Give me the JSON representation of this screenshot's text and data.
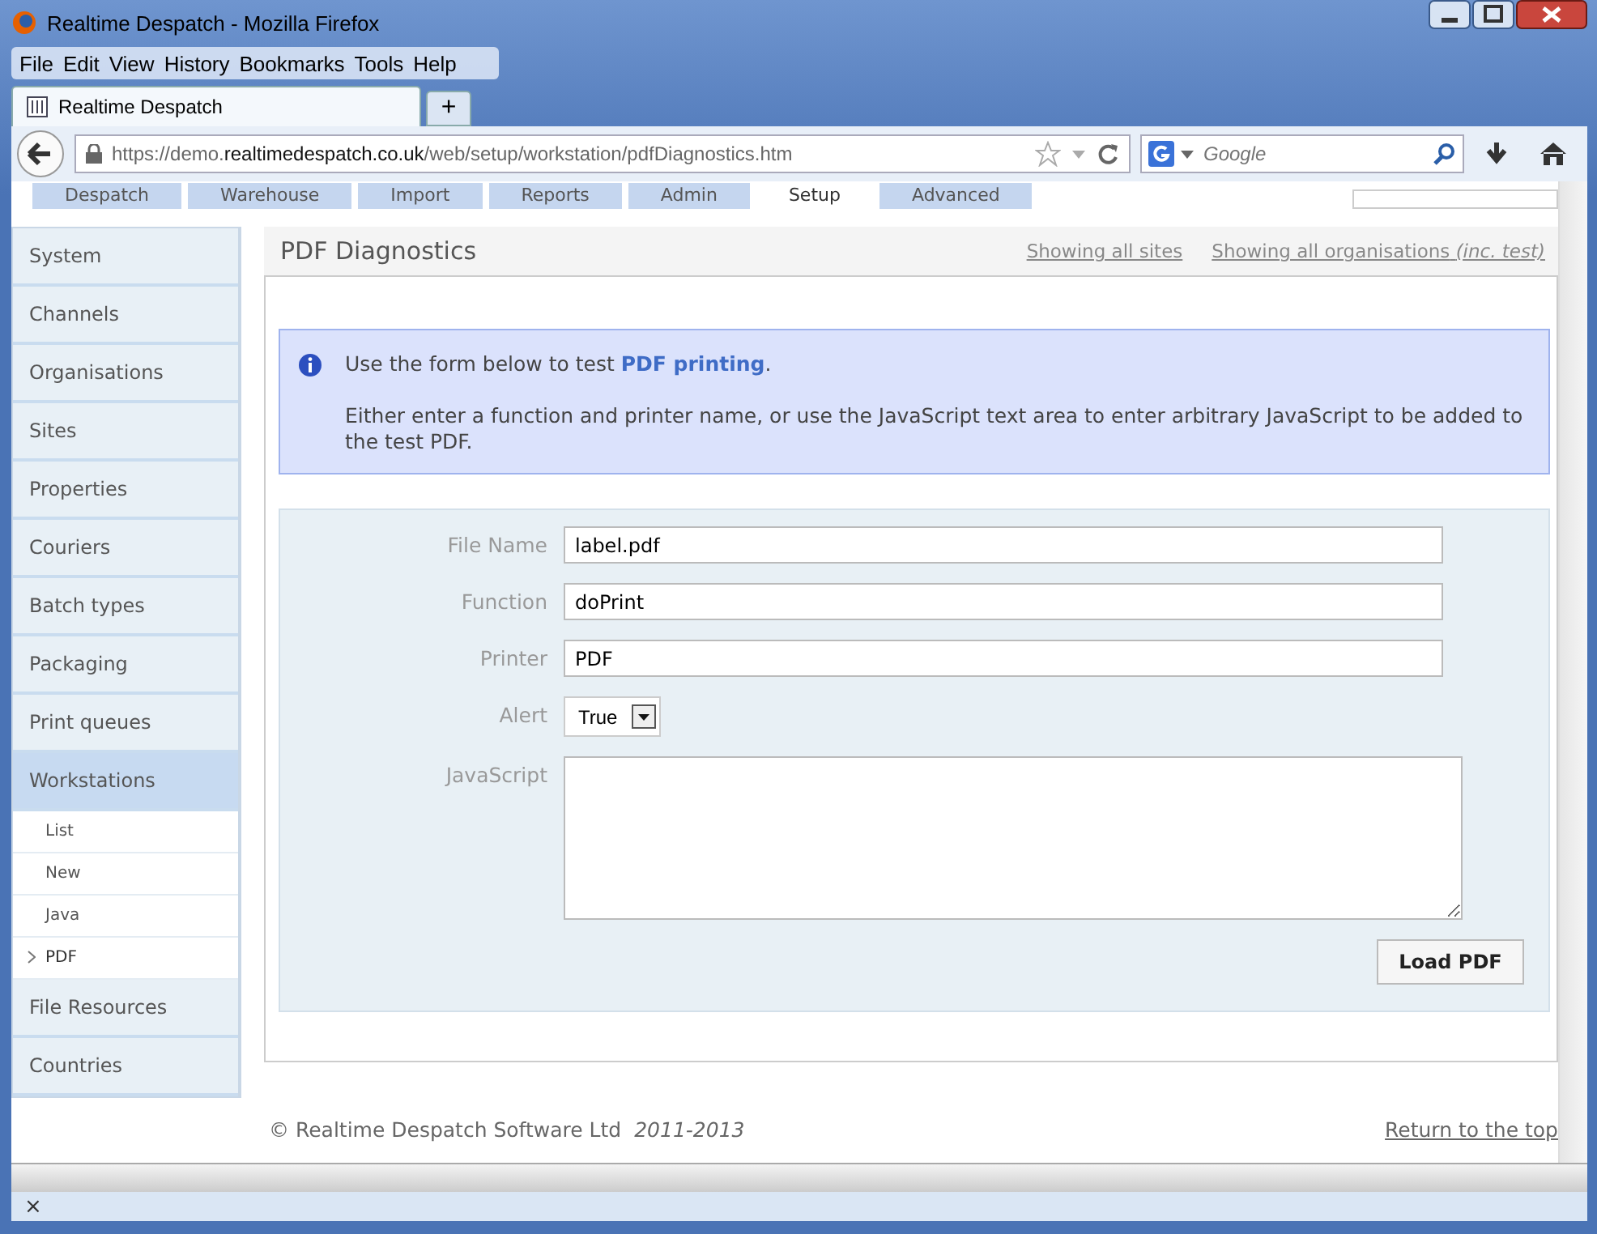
{
  "window": {
    "title": "Realtime Despatch - Mozilla Firefox"
  },
  "menu": [
    "File",
    "Edit",
    "View",
    "History",
    "Bookmarks",
    "Tools",
    "Help"
  ],
  "browser_tabs": [
    {
      "label": "Realtime Despatch",
      "selected": true
    }
  ],
  "new_tab": "+",
  "address": {
    "url": "https://demo.**realtimedespatch.co.uk**/web/setup/workstation/pdfDiagnostics.htm"
  },
  "search": {
    "placeholder": "Google"
  },
  "site_tabs": [
    {
      "label": "Despatch",
      "selected": false
    },
    {
      "label": "Warehouse",
      "selected": false
    },
    {
      "label": "Import",
      "selected": false
    },
    {
      "label": "Reports",
      "selected": false
    },
    {
      "label": "Admin",
      "selected": false
    },
    {
      "label": "Setup",
      "selected": true
    },
    {
      "label": "Advanced",
      "selected": false
    }
  ],
  "sidebar": {
    "items": [
      {
        "label": "System",
        "selected": false
      },
      {
        "label": "Channels",
        "selected": false
      },
      {
        "label": "Organisations",
        "selected": false
      },
      {
        "label": "Sites",
        "selected": false
      },
      {
        "label": "Properties",
        "selected": false
      },
      {
        "label": "Couriers",
        "selected": false
      },
      {
        "label": "Batch types",
        "selected": false
      },
      {
        "label": "Packaging",
        "selected": false
      },
      {
        "label": "Print queues",
        "selected": false
      },
      {
        "label": "Workstations",
        "selected": true,
        "children": [
          {
            "label": "List",
            "selected": false
          },
          {
            "label": "New",
            "selected": false
          },
          {
            "label": "Java",
            "selected": false
          },
          {
            "label": "PDF",
            "selected": true
          }
        ]
      },
      {
        "label": "File Resources",
        "selected": false
      },
      {
        "label": "Countries",
        "selected": false
      }
    ]
  },
  "page": {
    "title": "PDF Diagnostics",
    "filters": [
      {
        "text": "Showing all sites"
      },
      {
        "text": "Showing all organisations",
        "note": "(inc. test)"
      }
    ]
  },
  "info": {
    "before": "Use the form below to test",
    "link": "PDF printing",
    "after": ".",
    "detail": "Either enter a function and printer name, or use the JavaScript text area to enter arbitrary JavaScript to be added to the test PDF."
  },
  "form": {
    "fields": [
      {
        "kind": "text",
        "label": "File Name",
        "value": "label.pdf"
      },
      {
        "kind": "text",
        "label": "Function",
        "value": "doPrint"
      },
      {
        "kind": "text",
        "label": "Printer",
        "value": "PDF"
      },
      {
        "kind": "select",
        "label": "Alert",
        "value": "True"
      },
      {
        "kind": "textarea",
        "label": "JavaScript"
      }
    ],
    "button": "Load PDF"
  },
  "footer": {
    "copyright": "© Realtime Despatch Software Ltd",
    "years": "2011-2013",
    "top_link": "Return to the top"
  },
  "status_bar": {
    "close": "×"
  }
}
